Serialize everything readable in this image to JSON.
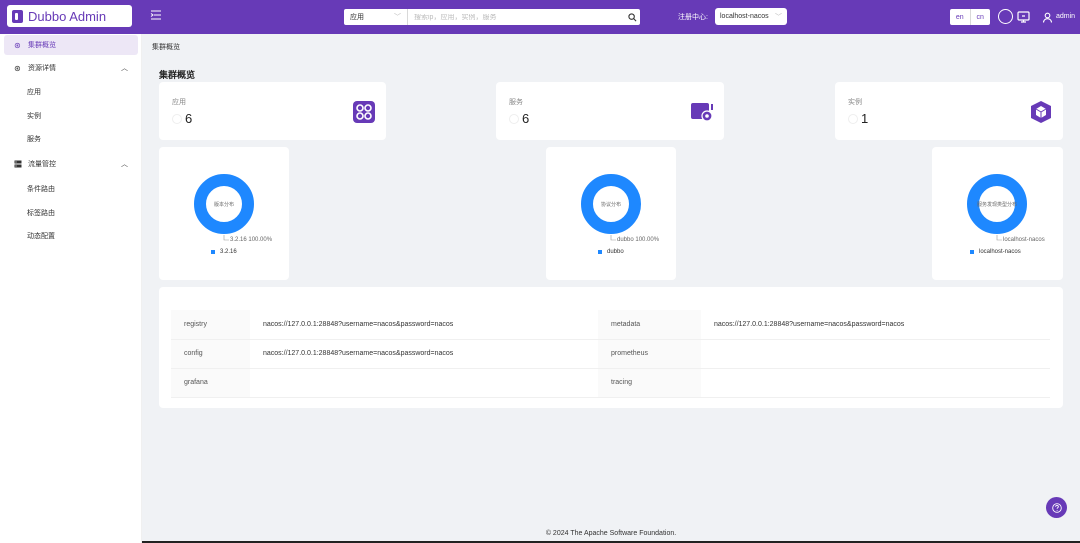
{
  "header": {
    "app_name": "Dubbo Admin",
    "search": {
      "scope": "应用",
      "placeholder": "搜索ip，应用，实例，服务"
    },
    "registry_label": "注册中心:",
    "registry_value": "localhost-nacos",
    "lang_en": "en",
    "lang_cn": "cn",
    "user": "admin"
  },
  "sidebar": {
    "items": [
      {
        "label": "集群概览",
        "icon": "cluster-icon"
      },
      {
        "label": "资源详情",
        "icon": "resource-icon",
        "children": [
          "应用",
          "实例",
          "服务"
        ]
      },
      {
        "label": "流量管控",
        "icon": "traffic-icon",
        "children": [
          "条件路由",
          "标签路由",
          "动态配置"
        ]
      }
    ]
  },
  "breadcrumb": "集群概览",
  "page_title": "集群概览",
  "stats": [
    {
      "label": "应用",
      "value": "6",
      "icon": "app-grid-icon"
    },
    {
      "label": "服务",
      "value": "6",
      "icon": "service-icon"
    },
    {
      "label": "实例",
      "value": "1",
      "icon": "instance-cube-icon"
    }
  ],
  "donuts": [
    {
      "center": "版本分布",
      "slice": "3.2.16",
      "percent": "100.00%",
      "legend": "3.2.16"
    },
    {
      "center": "协议分布",
      "slice": "dubbo",
      "percent": "100.00%",
      "legend": "dubbo"
    },
    {
      "center": "服务发现类型分布",
      "slice": "localhost-nacos",
      "percent": "",
      "legend": "localhost-nacos"
    }
  ],
  "config": {
    "rows": [
      {
        "k1": "registry",
        "v1": "nacos://127.0.0.1:28848?username=nacos&password=nacos",
        "k2": "metadata",
        "v2": "nacos://127.0.0.1:28848?username=nacos&password=nacos"
      },
      {
        "k1": "config",
        "v1": "nacos://127.0.0.1:28848?username=nacos&password=nacos",
        "k2": "prometheus",
        "v2": ""
      },
      {
        "k1": "grafana",
        "v1": "",
        "k2": "tracing",
        "v2": ""
      }
    ]
  },
  "footer": "© 2024 The Apache Software Foundation.",
  "colors": {
    "primary": "#673ab7",
    "chart": "#1e88ff"
  }
}
